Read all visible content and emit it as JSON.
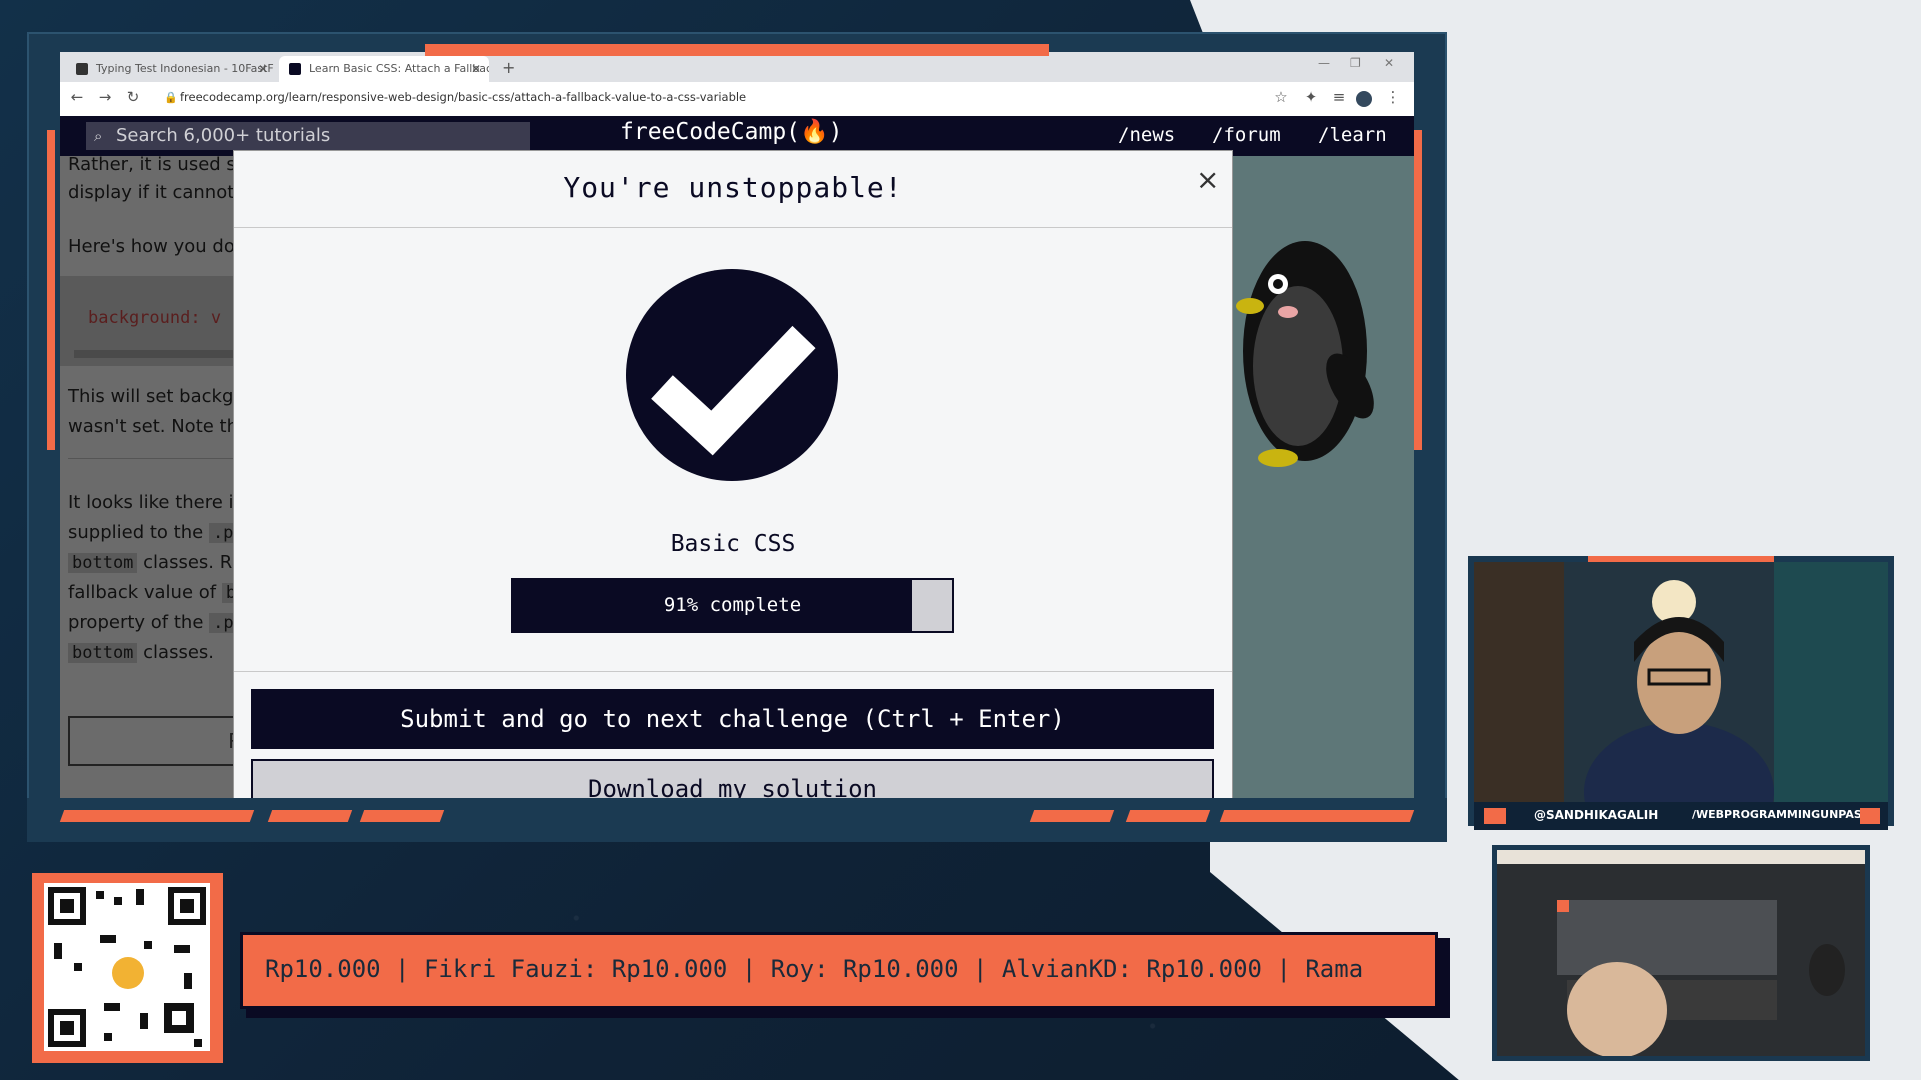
{
  "browser": {
    "tabs": [
      {
        "label": "Typing Test Indonesian - 10FastF",
        "active": false
      },
      {
        "label": "Learn Basic CSS: Attach a Fallbac",
        "active": true
      }
    ],
    "new_tab": "+",
    "url": "freecodecamp.org/learn/responsive-web-design/basic-css/attach-a-fallback-value-to-a-css-variable"
  },
  "fcc_nav": {
    "search_placeholder": "Search 6,000+ tutorials",
    "logo": "freeCodeCamp(🔥)",
    "links": [
      "/news",
      "/forum",
      "/learn"
    ]
  },
  "lesson_fragments": {
    "line1": "Rather, it is used so",
    "line2": "display if it cannot f",
    "line3": "Here's how you do",
    "code": "background: v",
    "line4": "This will set backgr",
    "line5": "wasn't set. Note th",
    "line6": "It looks like there is",
    "line7": "supplied to the",
    "line7_code": ".p",
    "line8_code": "bottom",
    "line8": "classes. Ra",
    "line9": "fallback value of",
    "line9_code": "b",
    "line10": "property of the",
    "line10_code": ".p",
    "line11_code": "bottom",
    "line11": "classes.",
    "button_fragment": "R"
  },
  "modal": {
    "title": "You're unstoppable!",
    "close": "×",
    "certification": "Basic CSS",
    "progress_percent": 91,
    "progress_label": "91% complete",
    "submit_label": "Submit and go to next challenge (Ctrl + Enter)",
    "download_label": "Download my solution"
  },
  "stream": {
    "handle_left": "@SANDHIKAGALIH",
    "handle_right": "/WEBPROGRAMMINGUNPAS",
    "ticker": "Rp10.000 | Fikri Fauzi: Rp10.000 | Roy: Rp10.000 | AlvianKD: Rp10.000 | Rama"
  },
  "colors": {
    "fcc_dark": "#0a0a23",
    "overlay_orange": "#f26b48",
    "overlay_navy": "#0f2236"
  }
}
